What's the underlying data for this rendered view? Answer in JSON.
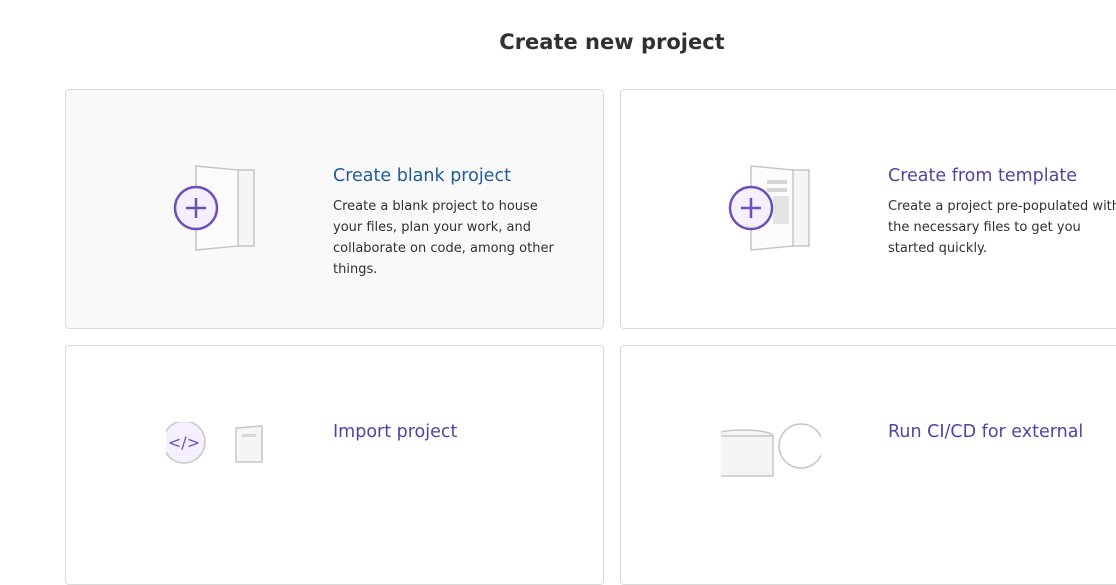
{
  "page": {
    "title": "Create new project"
  },
  "cards": [
    {
      "title": "Create blank project",
      "description": "Create a blank project to house your files, plan your work, and collaborate on code, among other things.",
      "icon": "blank-project-icon"
    },
    {
      "title": "Create from template",
      "description": "Create a project pre-populated with the necessary files to get you started quickly.",
      "icon": "template-project-icon"
    },
    {
      "title": "Import project",
      "description": "",
      "icon": "import-project-icon"
    },
    {
      "title": "Run CI/CD for external",
      "description": "",
      "icon": "ci-cd-external-icon"
    }
  ],
  "colors": {
    "accent": "#6b4fbb",
    "blank_title": "#1f5b9a",
    "template_title": "#5541a6",
    "card_border": "#dbdbdb",
    "active_card_bg": "#f9f9f9"
  }
}
